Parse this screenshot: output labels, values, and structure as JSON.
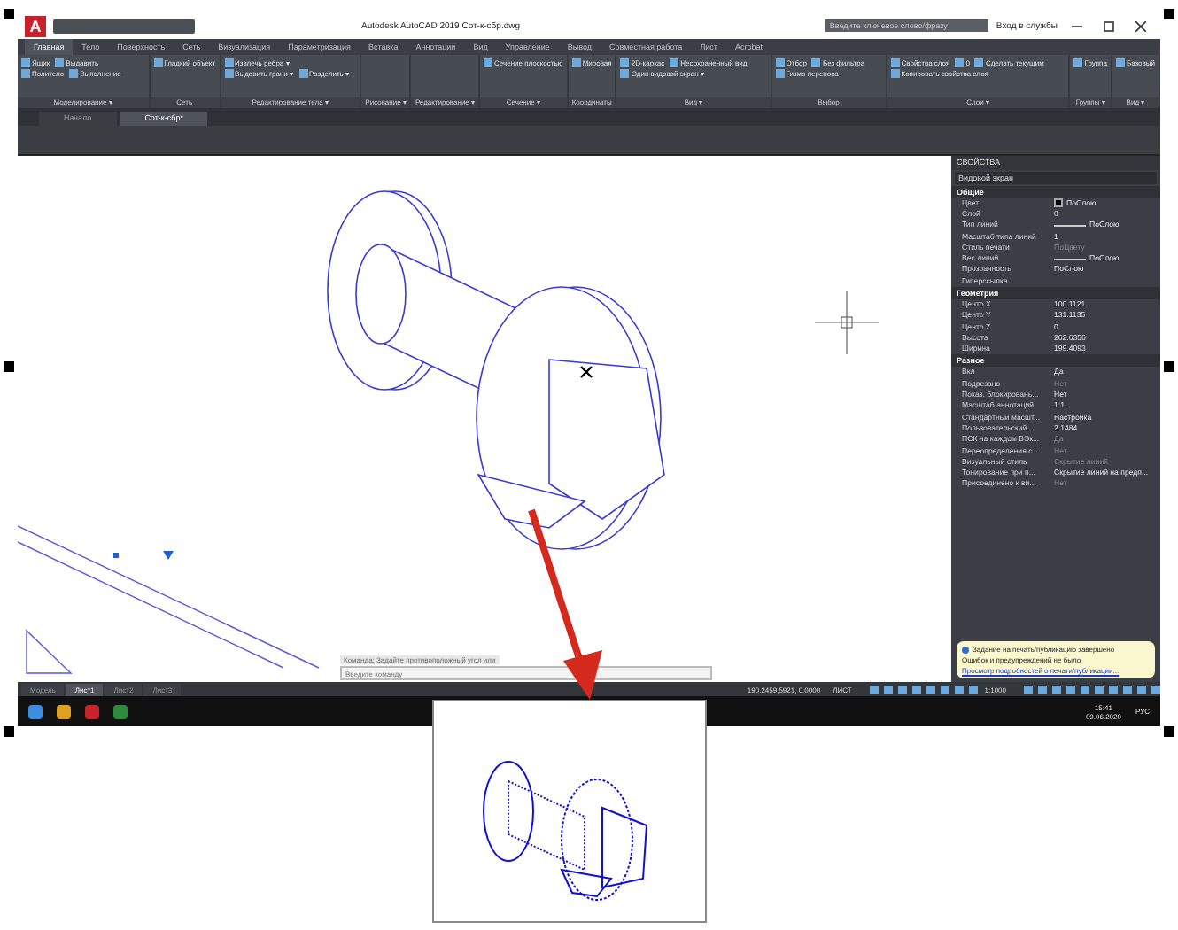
{
  "window": {
    "logo": "A",
    "title": "Autodesk AutoCAD 2019   Сот-к-сбр.dwg",
    "search": {
      "placeholder": "Введите ключевое слово/фразу"
    },
    "signin": "Вход в службы"
  },
  "ribbon_tabs": [
    {
      "label": "Главная",
      "selected": true
    },
    {
      "label": "Тело",
      "selected": false
    },
    {
      "label": "Поверхность",
      "selected": false
    },
    {
      "label": "Сеть",
      "selected": false
    },
    {
      "label": "Визуализация",
      "selected": false
    },
    {
      "label": "Параметризация",
      "selected": false
    },
    {
      "label": "Вставка",
      "selected": false
    },
    {
      "label": "Аннотации",
      "selected": false
    },
    {
      "label": "Вид",
      "selected": false
    },
    {
      "label": "Управление",
      "selected": false
    },
    {
      "label": "Вывод",
      "selected": false
    },
    {
      "label": "Совместная работа",
      "selected": false
    },
    {
      "label": "Лист",
      "selected": false
    },
    {
      "label": "Acrobat",
      "selected": false
    }
  ],
  "ribbon_panels": [
    {
      "title": "Моделирование ▾",
      "items": [
        "Ящик",
        "Выдавить",
        "Политело",
        "Выполнение"
      ]
    },
    {
      "title": "Сеть",
      "items": [
        "Гладкий объект"
      ]
    },
    {
      "title": "Редактирование тела ▾",
      "items": [
        "Извлечь ребра ▾",
        "Выдавить грани ▾",
        "Разделить ▾"
      ]
    },
    {
      "title": "Рисование ▾"
    },
    {
      "title": "Редактирование ▾"
    },
    {
      "title": "Сечение ▾",
      "items": [
        "Сечение плоскостью"
      ]
    },
    {
      "title": "Координаты",
      "items": [
        "Мировая"
      ]
    },
    {
      "title": "Вид ▾",
      "items": [
        "2D-каркас",
        "Несохраненный вид",
        "Один видовой экран ▾"
      ]
    },
    {
      "title": "Выбор",
      "items": [
        "Отбор",
        "Без фильтра",
        "Гизмо переноса"
      ]
    },
    {
      "title": "Слои ▾",
      "items": [
        "Свойства слоя",
        "0",
        "Сделать текущим",
        "Копировать свойства слоя"
      ]
    },
    {
      "title": "Группы ▾",
      "items": [
        "Группа"
      ]
    },
    {
      "title": "Вид ▾",
      "items": [
        "Базовый"
      ]
    }
  ],
  "file_tabs": [
    {
      "label": "Начало",
      "selected": false
    },
    {
      "label": "Сот-к-сбр*",
      "selected": true
    }
  ],
  "properties": {
    "title": "СВОЙСТВА",
    "selector": "Видовой экран",
    "sections": [
      {
        "title": "Общие",
        "rows": [
          {
            "label": "Цвет",
            "value": "ПоСлою",
            "kind": "color",
            "greyed": false
          },
          {
            "label": "Слой",
            "value": "0",
            "kind": "text",
            "greyed": false
          },
          {
            "label": "Тип линий",
            "value": "ПоСлою",
            "kind": "line",
            "greyed": false
          },
          {
            "label": "Масштаб типа линий",
            "value": "1",
            "kind": "text",
            "greyed": false
          },
          {
            "label": "Стиль печати",
            "value": "ПоЦвету",
            "kind": "text",
            "greyed": true
          },
          {
            "label": "Вес линий",
            "value": "ПоСлою",
            "kind": "line",
            "greyed": false
          },
          {
            "label": "Прозрачность",
            "value": "ПоСлою",
            "kind": "text",
            "greyed": false
          },
          {
            "label": "Гиперссылка"
          }
        ]
      },
      {
        "title": "Геометрия",
        "rows": [
          {
            "label": "Центр X",
            "value": "100.1121",
            "kind": "text",
            "greyed": false
          },
          {
            "label": "Центр Y",
            "value": "131.1135",
            "kind": "text",
            "greyed": false
          },
          {
            "label": "Центр Z",
            "value": "0",
            "kind": "text",
            "greyed": false
          },
          {
            "label": "Высота",
            "value": "262.6356",
            "kind": "text",
            "greyed": false
          },
          {
            "label": "Ширина",
            "value": "199.4093",
            "kind": "text",
            "greyed": false
          }
        ]
      },
      {
        "title": "Разное",
        "rows": [
          {
            "label": "Вкл",
            "value": "Да",
            "kind": "text",
            "greyed": false
          },
          {
            "label": "Подрезано",
            "value": "Нет",
            "kind": "text",
            "greyed": true
          },
          {
            "label": "Показ. блокировань...",
            "value": "Нет",
            "kind": "text",
            "greyed": false
          },
          {
            "label": "Масштаб аннотаций",
            "value": "1:1",
            "kind": "text",
            "greyed": false
          },
          {
            "label": "Стандартный масшт...",
            "value": "Настройка",
            "kind": "text",
            "greyed": false
          },
          {
            "label": "Пользовательский...",
            "value": "2.1484",
            "kind": "text",
            "greyed": false
          },
          {
            "label": "ПСК на каждом ВЭк...",
            "value": "Да",
            "kind": "text",
            "greyed": true
          },
          {
            "label": "Переопределения с...",
            "value": "Нет",
            "kind": "text",
            "greyed": true
          },
          {
            "label": "Визуальный стиль",
            "value": "Скрытие линий",
            "kind": "text",
            "greyed": true
          },
          {
            "label": "Тонирование при п...",
            "value": "Скрытие линий на предп...",
            "kind": "text",
            "greyed": false
          },
          {
            "label": "Присоединено к ви...",
            "value": "Нет",
            "kind": "text",
            "greyed": true
          }
        ]
      }
    ]
  },
  "command_line": {
    "prompt": "Команда: Задайте противоположный угол или",
    "placeholder": "Введите команду"
  },
  "notification": {
    "title": "Задание на печать/публикацию завершено",
    "message": "Ошибок и предупреждений не было",
    "link": "Просмотр подробностей о печати/публикации..."
  },
  "layout_tabs": [
    {
      "label": "Модель",
      "selected": false
    },
    {
      "label": "Лист1",
      "selected": true
    },
    {
      "label": "Лист2",
      "selected": false
    },
    {
      "label": "Лист3",
      "selected": false
    }
  ],
  "status_bar": {
    "coordinates": "190.2459,5921, 0.0000",
    "space": "ЛИСТ",
    "scale": "1:1000"
  },
  "taskbar": {
    "language": "РУС",
    "time": "15:41",
    "date": "09.06.2020"
  }
}
